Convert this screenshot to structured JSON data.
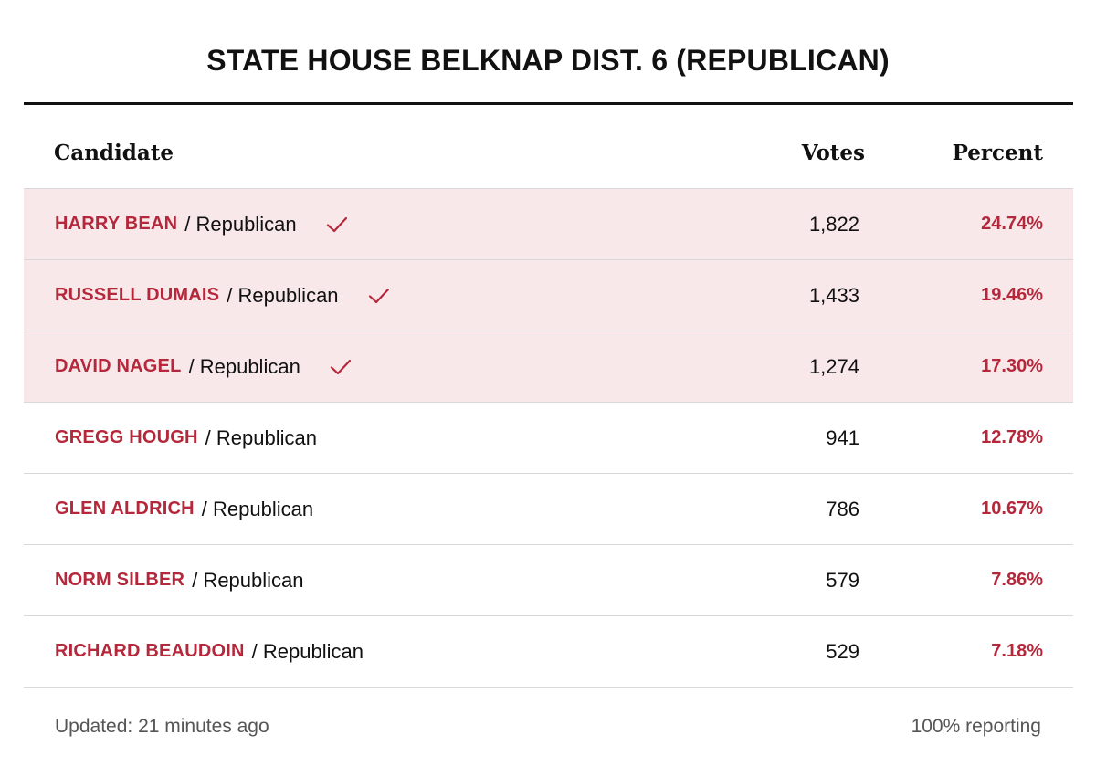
{
  "title": "STATE HOUSE BELKNAP DIST. 6 (REPUBLICAN)",
  "columns": {
    "candidate": "Candidate",
    "votes": "Votes",
    "percent": "Percent"
  },
  "candidates": [
    {
      "name": "HARRY BEAN",
      "party": "/ Republican",
      "votes": "1,822",
      "percent": "24.74%",
      "winner": true
    },
    {
      "name": "RUSSELL DUMAIS",
      "party": "/ Republican",
      "votes": "1,433",
      "percent": "19.46%",
      "winner": true
    },
    {
      "name": "DAVID NAGEL",
      "party": "/ Republican",
      "votes": "1,274",
      "percent": "17.30%",
      "winner": true
    },
    {
      "name": "GREGG HOUGH",
      "party": "/ Republican",
      "votes": "941",
      "percent": "12.78%",
      "winner": false
    },
    {
      "name": "GLEN ALDRICH",
      "party": "/ Republican",
      "votes": "786",
      "percent": "10.67%",
      "winner": false
    },
    {
      "name": "NORM SILBER",
      "party": "/ Republican",
      "votes": "579",
      "percent": "7.86%",
      "winner": false
    },
    {
      "name": "RICHARD BEAUDOIN",
      "party": "/ Republican",
      "votes": "529",
      "percent": "7.18%",
      "winner": false
    }
  ],
  "footer": {
    "updated": "Updated: 21 minutes ago",
    "reporting": "100% reporting"
  },
  "colors": {
    "accent": "#b5283b",
    "winner_bg": "#f8e8ea",
    "text": "#111111",
    "muted": "#555555"
  },
  "icons": {
    "winner": "checkmark-icon"
  }
}
